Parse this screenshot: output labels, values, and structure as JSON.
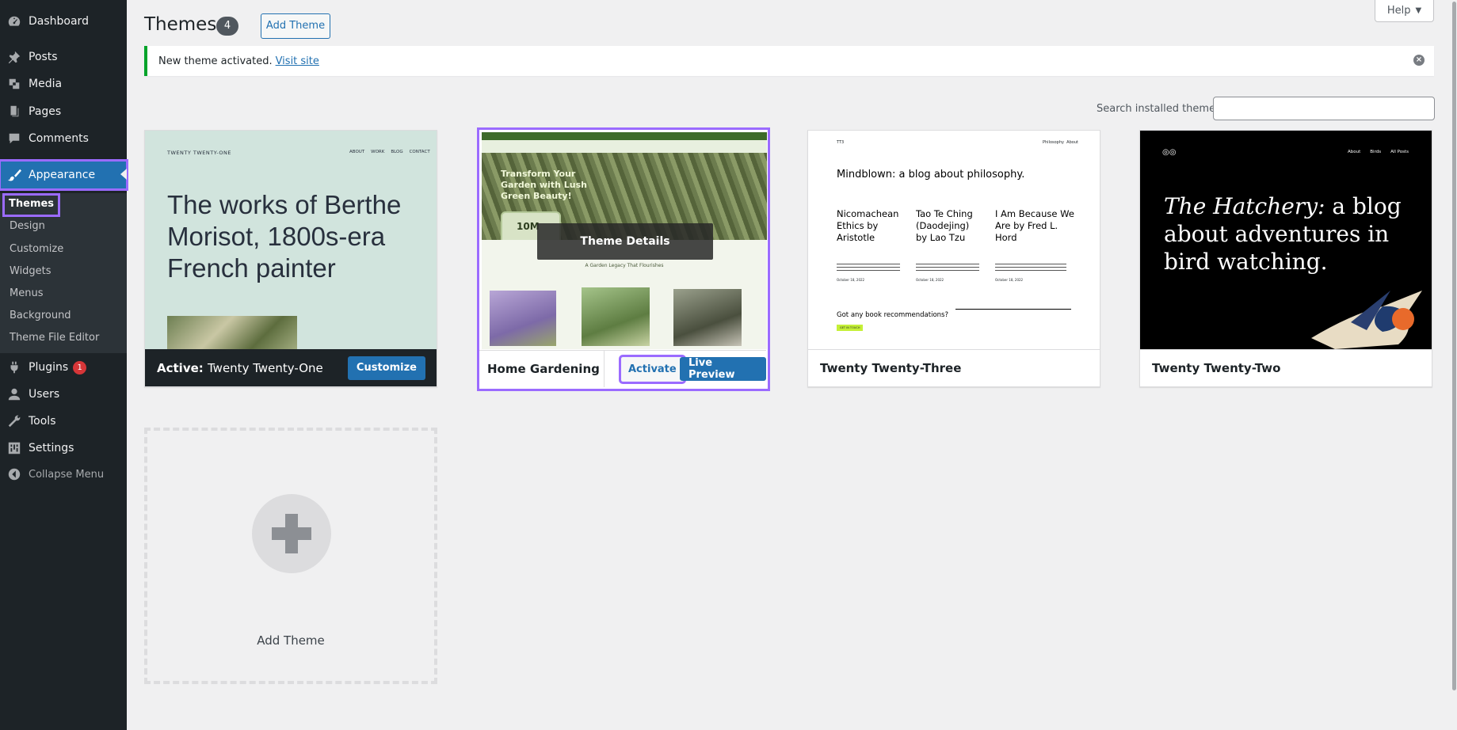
{
  "sidebar": {
    "items": [
      {
        "label": "Dashboard",
        "icon": "dashboard-icon"
      },
      {
        "label": "Posts",
        "icon": "pin-icon"
      },
      {
        "label": "Media",
        "icon": "media-icon"
      },
      {
        "label": "Pages",
        "icon": "pages-icon"
      },
      {
        "label": "Comments",
        "icon": "comment-icon"
      },
      {
        "label": "Appearance",
        "icon": "brush-icon"
      },
      {
        "label": "Plugins",
        "icon": "plugin-icon",
        "badge": "1"
      },
      {
        "label": "Users",
        "icon": "user-icon"
      },
      {
        "label": "Tools",
        "icon": "wrench-icon"
      },
      {
        "label": "Settings",
        "icon": "settings-icon"
      },
      {
        "label": "Collapse Menu",
        "icon": "collapse-icon"
      }
    ],
    "submenu": [
      "Themes",
      "Design",
      "Customize",
      "Widgets",
      "Menus",
      "Background",
      "Theme File Editor"
    ]
  },
  "header": {
    "title": "Themes",
    "count": "4",
    "add_button": "Add Theme",
    "help": "Help"
  },
  "notice": {
    "text": "New theme activated.",
    "link": "Visit site"
  },
  "search": {
    "label": "Search installed themes",
    "value": ""
  },
  "themes": {
    "t1": {
      "active_prefix": "Active:",
      "name": "Twenty Twenty-One",
      "button": "Customize",
      "preview_site": "TWENTY TWENTY-ONE",
      "preview_nav": [
        "ABOUT",
        "WORK",
        "BLOG",
        "CONTACT"
      ],
      "preview_heading": "The works of Berthe Morisot, 1800s-era French painter"
    },
    "t2": {
      "name": "Home Gardening",
      "overlay": "Theme Details",
      "activate": "Activate",
      "live_preview": "Live Preview",
      "preview_heading": "Transform Your Garden with Lush Green Beauty!",
      "preview_stat": "10M",
      "preview_sub": "A Garden Legacy That Flourishes"
    },
    "t3": {
      "name": "Twenty Twenty-Three",
      "preview_site": "TT3",
      "preview_nav": "Philosophy  About",
      "preview_heading": "Mindblown: a blog about philosophy.",
      "posts": [
        "Nicomachean Ethics by Aristotle",
        "Tao Te Ching (Daodejing) by Lao Tzu",
        "I Am Because We Are by Fred L. Hord"
      ],
      "dates": [
        "October 18, 2022",
        "October 18, 2022",
        "October 18, 2022"
      ],
      "cta": "Got any book recommendations?",
      "cta_button": "GET IN TOUCH"
    },
    "t4": {
      "name": "Twenty Twenty-Two",
      "preview_nav": [
        "About",
        "Birds",
        "All Posts"
      ],
      "preview_heading_italic": "The Hatchery:",
      "preview_heading_rest": " a blog about adventures in bird watching."
    }
  },
  "add_theme": {
    "label": "Add Theme"
  },
  "colors": {
    "accent": "#2271b1",
    "highlight": "#9b6bff",
    "sidebar": "#1d2327",
    "success": "#00a32a"
  }
}
